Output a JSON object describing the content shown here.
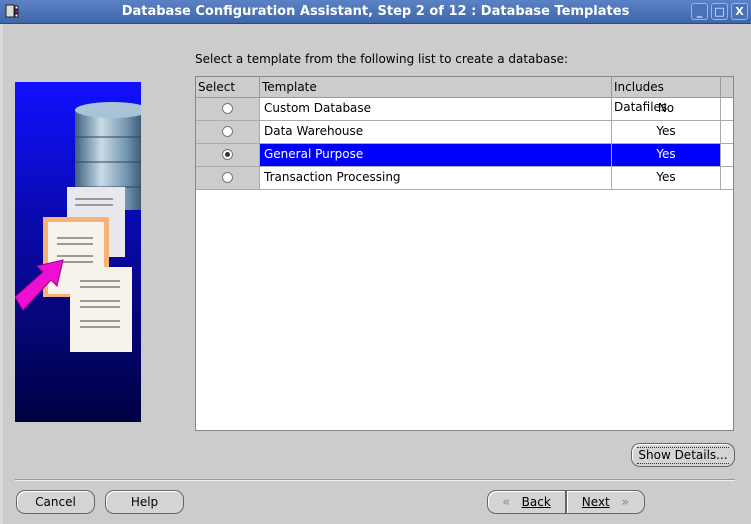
{
  "window": {
    "title": "Database Configuration Assistant, Step 2 of 12 : Database Templates",
    "controls": [
      "minimize",
      "maximize",
      "close"
    ]
  },
  "instructions": "Select a template from the following list to create a database:",
  "table": {
    "columns": [
      "Select",
      "Template",
      "Includes Datafiles"
    ],
    "rows": [
      {
        "selected": false,
        "template": "Custom Database",
        "includes_datafiles": "No"
      },
      {
        "selected": false,
        "template": "Data Warehouse",
        "includes_datafiles": "Yes"
      },
      {
        "selected": true,
        "template": "General Purpose",
        "includes_datafiles": "Yes"
      },
      {
        "selected": false,
        "template": "Transaction Processing",
        "includes_datafiles": "Yes"
      }
    ]
  },
  "buttons": {
    "show_details": "Show Details...",
    "cancel": "Cancel",
    "help": "Help",
    "back": "Back",
    "next": "Next"
  },
  "colors": {
    "selection": "#0000ff",
    "titlebar": "#4a72b6"
  }
}
